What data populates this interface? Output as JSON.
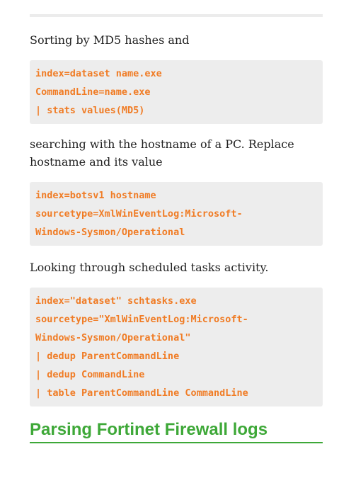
{
  "paragraphs": {
    "p1": "Sorting by MD5 hashes and",
    "p2": "searching with the hostname of a PC. Replace hostname and its value",
    "p3": "Looking through scheduled tasks activity."
  },
  "code_blocks": {
    "block1": [
      "index=dataset name.exe",
      "CommandLine=name.exe",
      "| stats values(MD5)"
    ],
    "block2": [
      "index=botsv1 hostname",
      "sourcetype=XmlWinEventLog:Microsoft-",
      "Windows-Sysmon/Operational"
    ],
    "block3": [
      "index=\"dataset\" schtasks.exe",
      "sourcetype=\"XmlWinEventLog:Microsoft-",
      "Windows-Sysmon/Operational\"",
      "| dedup ParentCommandLine",
      "| dedup CommandLine",
      "| table ParentCommandLine CommandLine"
    ]
  },
  "heading": {
    "text": "Parsing Fortinet Firewall logs"
  },
  "colors": {
    "code_text": "#f07c25",
    "code_background": "#ededed",
    "heading": "#3ea838",
    "body_text": "#222222"
  }
}
